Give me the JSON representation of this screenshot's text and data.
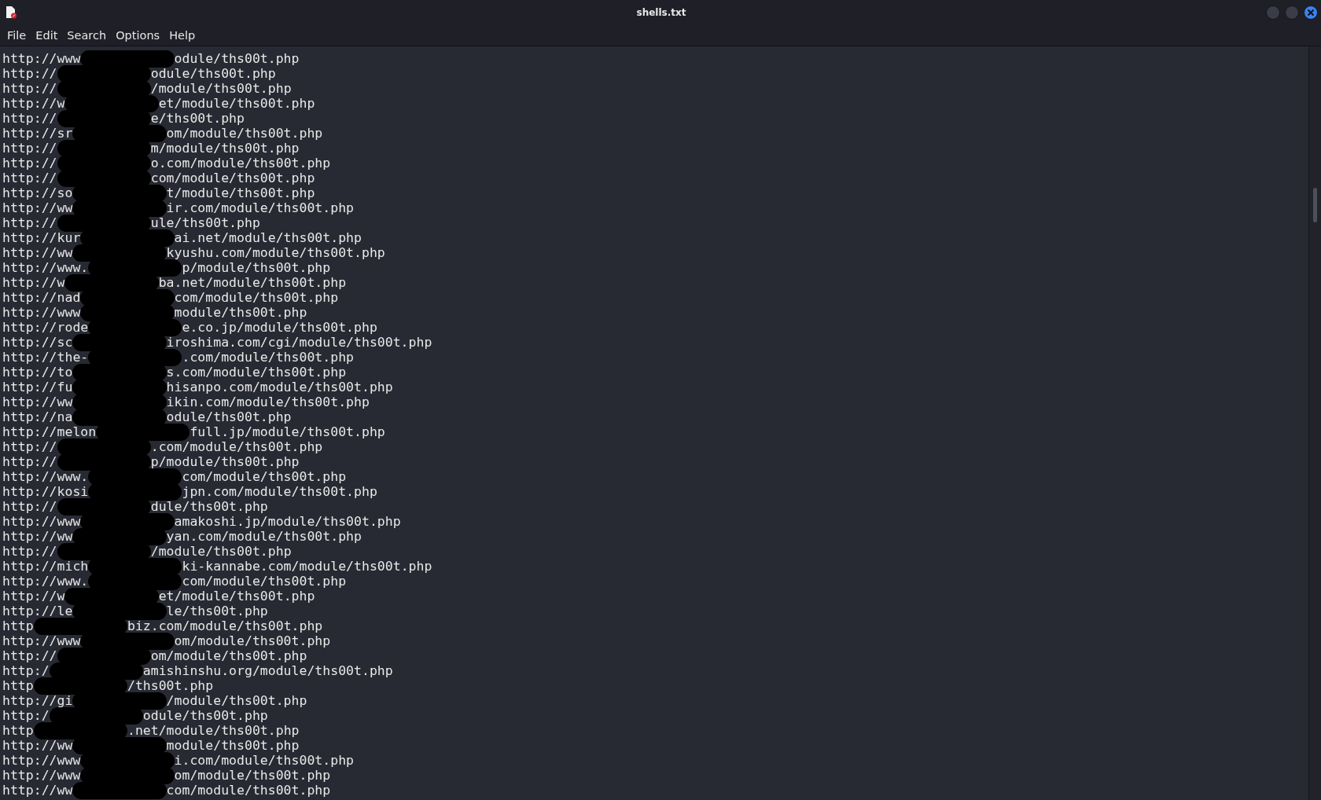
{
  "window": {
    "title": "shells.txt"
  },
  "menu": [
    "File",
    "Edit",
    "Search",
    "Options",
    "Help"
  ],
  "lines": [
    {
      "start": "http://www",
      "end": "odule/ths00t.php"
    },
    {
      "start": "http://",
      "end": "odule/ths00t.php"
    },
    {
      "start": "http://",
      "end": "/module/ths00t.php"
    },
    {
      "start": "http://w",
      "end": "et/module/ths00t.php"
    },
    {
      "start": "http://",
      "end": "e/ths00t.php"
    },
    {
      "start": "http://sr",
      "end": "om/module/ths00t.php"
    },
    {
      "start": "http://",
      "end": "m/module/ths00t.php"
    },
    {
      "start": "http://",
      "end": "o.com/module/ths00t.php"
    },
    {
      "start": "http://",
      "end": "com/module/ths00t.php"
    },
    {
      "start": "http://so",
      "end": "t/module/ths00t.php"
    },
    {
      "start": "http://ww",
      "end": "ir.com/module/ths00t.php"
    },
    {
      "start": "http://",
      "end": "ule/ths00t.php"
    },
    {
      "start": "http://kur",
      "end": "ai.net/module/ths00t.php"
    },
    {
      "start": "http://ww",
      "end": "kyushu.com/module/ths00t.php"
    },
    {
      "start": "http://www.",
      "end": "p/module/ths00t.php"
    },
    {
      "start": "http://w",
      "end": "ba.net/module/ths00t.php"
    },
    {
      "start": "http://nad",
      "end": "com/module/ths00t.php"
    },
    {
      "start": "http://www",
      "end": "module/ths00t.php"
    },
    {
      "start": "http://rode",
      "end": "e.co.jp/module/ths00t.php"
    },
    {
      "start": "http://sc",
      "end": "iroshima.com/cgi/module/ths00t.php"
    },
    {
      "start": "http://the-",
      "end": ".com/module/ths00t.php"
    },
    {
      "start": "http://to",
      "end": "s.com/module/ths00t.php"
    },
    {
      "start": "http://fu",
      "end": "hisanpo.com/module/ths00t.php"
    },
    {
      "start": "http://ww",
      "end": "ikin.com/module/ths00t.php"
    },
    {
      "start": "http://na",
      "end": "odule/ths00t.php"
    },
    {
      "start": "http://melon",
      "end": "full.jp/module/ths00t.php"
    },
    {
      "start": "http://",
      "end": ".com/module/ths00t.php"
    },
    {
      "start": "http://",
      "end": "p/module/ths00t.php"
    },
    {
      "start": "http://www.",
      "end": "com/module/ths00t.php"
    },
    {
      "start": "http://kosi",
      "end": "jpn.com/module/ths00t.php"
    },
    {
      "start": "http://",
      "end": "dule/ths00t.php"
    },
    {
      "start": "http://www",
      "end": "amakoshi.jp/module/ths00t.php"
    },
    {
      "start": "http://ww",
      "end": "yan.com/module/ths00t.php"
    },
    {
      "start": "http://",
      "end": "/module/ths00t.php"
    },
    {
      "start": "http://mich",
      "end": "ki-kannabe.com/module/ths00t.php"
    },
    {
      "start": "http://www.",
      "end": "com/module/ths00t.php"
    },
    {
      "start": "http://w",
      "end": "et/module/ths00t.php"
    },
    {
      "start": "http://le",
      "end": "le/ths00t.php"
    },
    {
      "start": "http",
      "end": "biz.com/module/ths00t.php"
    },
    {
      "start": "http://www",
      "end": "om/module/ths00t.php"
    },
    {
      "start": "http://",
      "end": "om/module/ths00t.php"
    },
    {
      "start": "http:/",
      "end": "amishinshu.org/module/ths00t.php"
    },
    {
      "start": "http",
      "end": "/ths00t.php"
    },
    {
      "start": "http://gi",
      "end": "/module/ths00t.php"
    },
    {
      "start": "http:/",
      "end": "odule/ths00t.php"
    },
    {
      "start": "http",
      "end": ".net/module/ths00t.php"
    },
    {
      "start": "http://ww",
      "end": "module/ths00t.php"
    },
    {
      "start": "http://www",
      "end": "i.com/module/ths00t.php"
    },
    {
      "start": "http://www",
      "end": "om/module/ths00t.php"
    },
    {
      "start": "http://ww",
      "end": "com/module/ths00t.php"
    }
  ]
}
